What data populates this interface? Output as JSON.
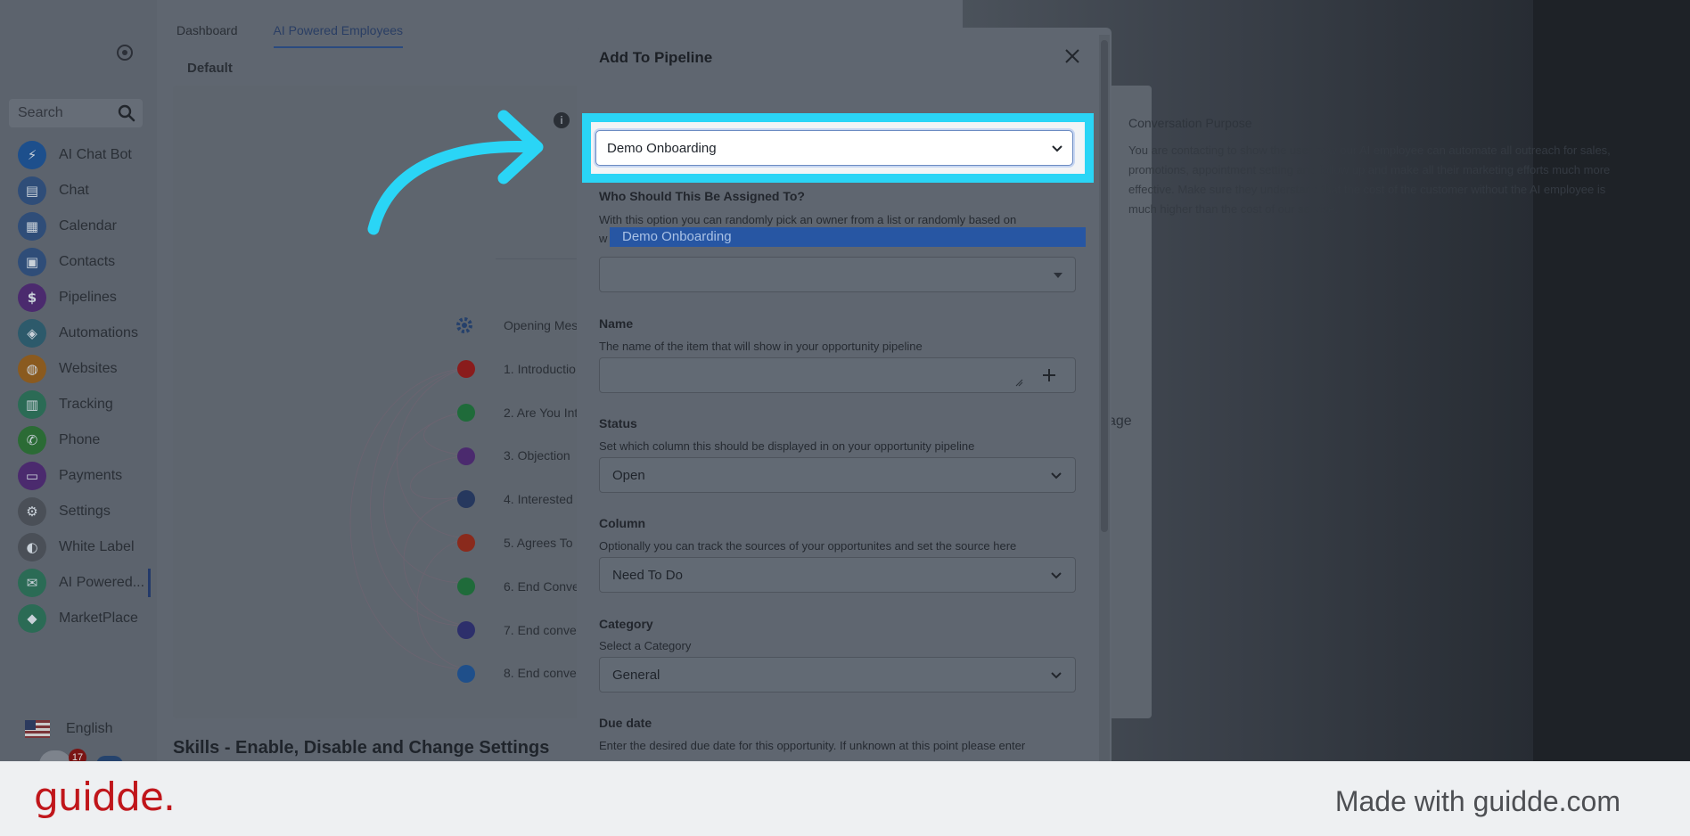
{
  "sidebar": {
    "search_placeholder": "Search",
    "items": [
      {
        "label": "AI Chat Bot",
        "icon": "bolt-icon",
        "color": "#1d4f8c",
        "glyph": "⚡"
      },
      {
        "label": "Chat",
        "icon": "chat-icon",
        "color": "#2f4d78",
        "glyph": "▤"
      },
      {
        "label": "Calendar",
        "icon": "calendar-icon",
        "color": "#2f4d78",
        "glyph": "▦"
      },
      {
        "label": "Contacts",
        "icon": "contacts-icon",
        "color": "#2f4d78",
        "glyph": "▣"
      },
      {
        "label": "Pipelines",
        "icon": "dollar-icon",
        "color": "#4b2a6e",
        "glyph": "$"
      },
      {
        "label": "Automations",
        "icon": "automation-icon",
        "color": "#2d5a6b",
        "glyph": "◈"
      },
      {
        "label": "Websites",
        "icon": "websites-icon",
        "color": "#8a5a1f",
        "glyph": "◍"
      },
      {
        "label": "Tracking",
        "icon": "tracking-icon",
        "color": "#2b6b55",
        "glyph": "▥"
      },
      {
        "label": "Phone",
        "icon": "phone-icon",
        "color": "#2b6b35",
        "glyph": "✆"
      },
      {
        "label": "Payments",
        "icon": "payments-icon",
        "color": "#4b2a6e",
        "glyph": "▭"
      },
      {
        "label": "Settings",
        "icon": "gear-icon",
        "color": "#4a4f57",
        "glyph": "⚙"
      },
      {
        "label": "White Label",
        "icon": "palette-icon",
        "color": "#4a4f57",
        "glyph": "◐"
      },
      {
        "label": "AI Powered...",
        "icon": "ai-chat-icon",
        "color": "#2b6b55",
        "glyph": "✉"
      },
      {
        "label": "MarketPlace",
        "icon": "marketplace-icon",
        "color": "#2b6b55",
        "glyph": "⬥"
      }
    ],
    "language": "English",
    "notification_count": "17"
  },
  "main": {
    "tabs": [
      "Dashboard",
      "AI Powered Employees"
    ],
    "sub_tab": "Default",
    "steps": [
      "Opening Mes",
      "1. Introductio",
      "2. Are You Int",
      "3. Objection",
      "4. Interested",
      "5. Agrees To",
      "6. End Conve",
      "7. End conve",
      "8. End conve"
    ],
    "dot_colors": [
      "#8a1c1c",
      "#1f6b3a",
      "#4b2a6e",
      "#26385e",
      "#8a2a1c",
      "#1f6b3a",
      "#2d2f6b",
      "#1f4f8a"
    ],
    "skills_title": "Skills - Enable, Disable and Change Settings",
    "conversation_title": "Conversation Purpose",
    "conversation_text": "You are contacting to show the user how our AI employee can automate all outreach for sales, promotions, appointment setting and follow up and make all their marketing efforts much more effective. Make sure they understand that the cost of the customer without the AI employee is much higher than the cost of our service.",
    "stage_label": "age"
  },
  "modal": {
    "title": "Add To Pipeline",
    "pipeline_value": "Demo Onboarding",
    "assign_label": "Who Should This Be Assigned To?",
    "assign_desc_1": "With this option you can randomly pick an owner from a list or randomly based on",
    "assign_desc_2": "w",
    "dropdown_option": "Demo Onboarding",
    "name_label": "Name",
    "name_desc": "The name of the item that will show in your opportunity pipeline",
    "status_label": "Status",
    "status_desc": "Set which column this should be displayed in on your opportunity pipeline",
    "status_value": "Open",
    "column_label": "Column",
    "column_desc": "Optionally you can track the sources of your opportunites and set the source here",
    "column_value": "Need To Do",
    "category_label": "Category",
    "category_desc": "Select a Category",
    "category_value": "General",
    "due_label": "Due date",
    "due_desc": "Enter the desired due date for this opportunity. If unknown at this point please enter"
  },
  "footer": {
    "brand": "guidde.",
    "made_with": "Made with guidde.com"
  },
  "colors": {
    "accent_cyan": "#2ad5f6",
    "brand_red": "#c0161b",
    "highlight_blue": "#2756a3"
  }
}
